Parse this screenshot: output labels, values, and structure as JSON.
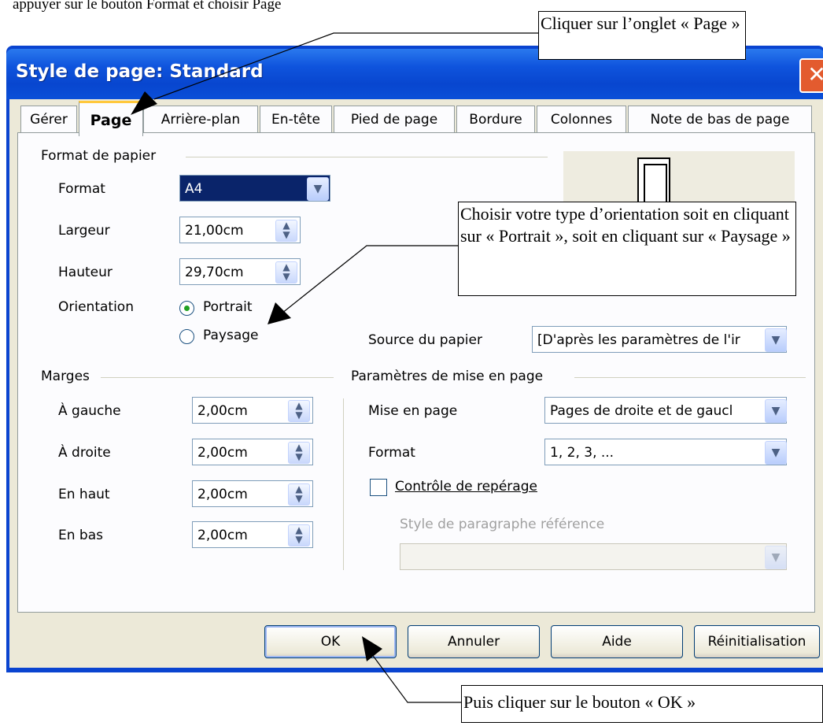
{
  "top_text": "appuyer sur le bouton Format et choisir Page",
  "dialog": {
    "title": "Style de page: Standard",
    "close_glyph": "✕"
  },
  "tabs": [
    {
      "label": "Gérer"
    },
    {
      "label": "Page"
    },
    {
      "label": "Arrière-plan"
    },
    {
      "label": "En-tête"
    },
    {
      "label": "Pied de page"
    },
    {
      "label": "Bordure"
    },
    {
      "label": "Colonnes"
    },
    {
      "label": "Note de bas de page"
    }
  ],
  "paper": {
    "section_title": "Format de papier",
    "format_label": "Format",
    "format_value": "A4",
    "width_label": "Largeur",
    "width_value": "21,00cm",
    "height_label": "Hauteur",
    "height_value": "29,70cm",
    "orientation_label": "Orientation",
    "portrait_label": "Portrait",
    "landscape_label": "Paysage",
    "source_label": "Source du papier",
    "source_value": "[D'après les paramètres de l'ir"
  },
  "margins": {
    "section_title": "Marges",
    "left_label": "À gauche",
    "left_value": "2,00cm",
    "right_label": "À droite",
    "right_value": "2,00cm",
    "top_label": "En haut",
    "top_value": "2,00cm",
    "bottom_label": "En bas",
    "bottom_value": "2,00cm"
  },
  "layout": {
    "section_title": "Paramètres de mise en page",
    "page_layout_label": "Mise en page",
    "page_layout_value": "Pages de droite et de gaucl",
    "format_label": "Format",
    "format_value": "1, 2, 3, ...",
    "register_label": "Contrôle de repérage",
    "ref_style_label": "Style de paragraphe référence",
    "ref_style_value": ""
  },
  "buttons": {
    "ok": "OK",
    "cancel": "Annuler",
    "help": "Aide",
    "reset": "Réinitialisation"
  },
  "callouts": {
    "tab": "Cliquer sur l’onglet « Page »",
    "orientation": "Choisir votre type d’orientation soit en cliquant sur « Portrait », soit en cliquant sur « Paysage »",
    "ok": "Puis cliquer sur le bouton « OK »"
  },
  "colors": {
    "titlebar": "#0a4fd8",
    "active_tab_accent": "#ffc83c",
    "selection": "#0a246a",
    "radio_checked": "#21a121"
  }
}
